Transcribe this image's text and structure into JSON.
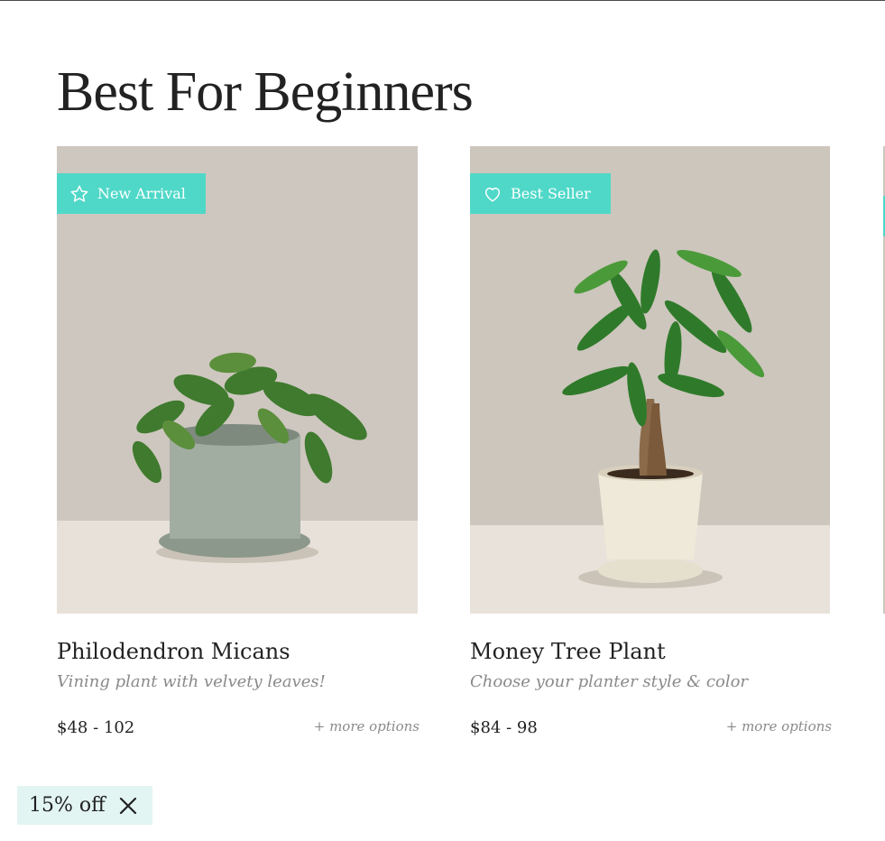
{
  "section": {
    "title": "Best For Beginners"
  },
  "products": [
    {
      "badge": {
        "label": "New Arrival",
        "icon": "star-icon"
      },
      "name": "Philodendron Micans",
      "description": "Vining plant with velvety leaves!",
      "price": "$48 - 102",
      "more": "+ more options",
      "pot_color": "#9aa69a"
    },
    {
      "badge": {
        "label": "Best Seller",
        "icon": "heart-icon"
      },
      "name": "Money Tree Plant",
      "description": "Choose your planter style & color",
      "price": "$84 - 98",
      "more": "+ more options",
      "pot_color": "#efe9d9"
    }
  ],
  "promo": {
    "label": "15% off",
    "icon": "close-icon"
  },
  "colors": {
    "accent": "#4fd8c8",
    "promo_bg": "#e2f5f2",
    "photo_bg": "#cdc6be"
  }
}
